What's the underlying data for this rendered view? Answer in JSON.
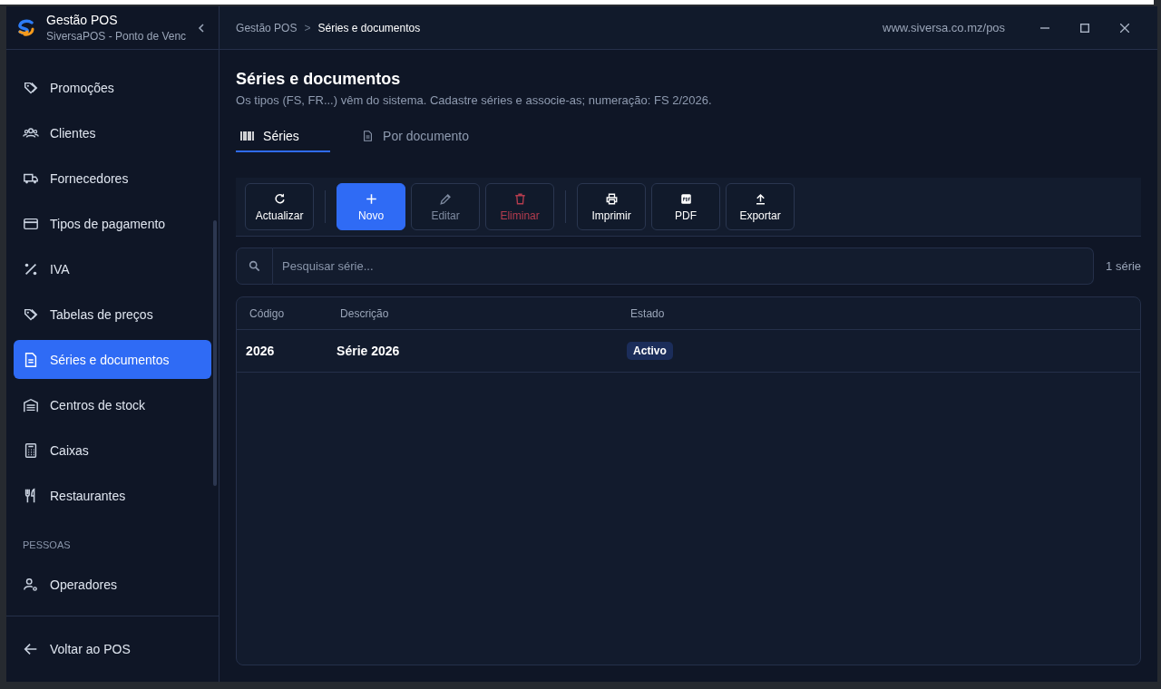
{
  "window": {
    "title": "Gestão POS",
    "subtitle": "SiversaPOS - Ponto de Venc",
    "url": "www.siversa.co.mz/pos"
  },
  "breadcrumb": [
    "Gestão POS",
    "Séries e documentos"
  ],
  "breadcrumb_separator": ">",
  "sidebar": {
    "items": [
      {
        "kind": "item",
        "label": "Promoções",
        "selected": false
      },
      {
        "kind": "item",
        "label": "Clientes",
        "selected": false
      },
      {
        "kind": "item",
        "label": "Fornecedores",
        "selected": false
      },
      {
        "kind": "item",
        "label": "Tipos de pagamento",
        "selected": false
      },
      {
        "kind": "item",
        "label": "IVA",
        "selected": false
      },
      {
        "kind": "item",
        "label": "Tabelas de preços",
        "selected": false
      },
      {
        "kind": "item",
        "label": "Séries e documentos",
        "selected": true
      },
      {
        "kind": "item",
        "label": "Centros de stock",
        "selected": false
      },
      {
        "kind": "item",
        "label": "Caixas",
        "selected": false
      },
      {
        "kind": "item",
        "label": "Restaurantes",
        "selected": false
      },
      {
        "kind": "heading",
        "label": "PESSOAS"
      },
      {
        "kind": "item",
        "label": "Operadores",
        "selected": false
      }
    ],
    "footer": "Voltar ao POS"
  },
  "page": {
    "title": "Séries e documentos",
    "description": "Os tipos (FS, FR...) vêm do sistema. Cadastre séries e associe-as; numeração: FS 2/2026."
  },
  "tabs": [
    {
      "label": "Séries",
      "selected": true
    },
    {
      "label": "Por documento",
      "selected": false
    }
  ],
  "toolbar": [
    [
      {
        "label": "Actualizar",
        "kind": "normal",
        "disabled": false
      }
    ],
    [
      {
        "label": "Novo",
        "kind": "primary",
        "disabled": false
      },
      {
        "label": "Editar",
        "kind": "normal",
        "disabled": true
      },
      {
        "label": "Eliminar",
        "kind": "danger",
        "disabled": true
      }
    ],
    [
      {
        "label": "Imprimir",
        "kind": "normal",
        "disabled": false
      },
      {
        "label": "PDF",
        "kind": "normal",
        "disabled": false
      },
      {
        "label": "Exportar",
        "kind": "normal",
        "disabled": false
      }
    ]
  ],
  "search": {
    "placeholder": "Pesquisar série...",
    "count": "1 série"
  },
  "table": {
    "columns": [
      "Código",
      "Descrição",
      "Estado"
    ],
    "rows": [
      {
        "code": "2026",
        "description": "Série 2026",
        "status": "Activo"
      }
    ]
  }
}
